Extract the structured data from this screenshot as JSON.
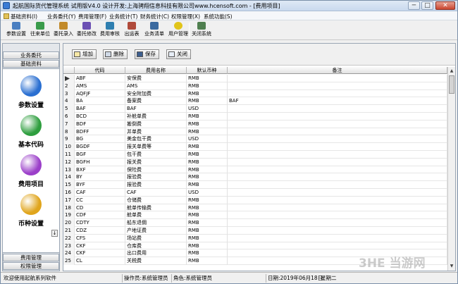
{
  "window": {
    "title": "起航国际货代管理系统 试用版V4.0 设计开发:上海骋翔信息科技有限公司www.hcensoft.com - [费用项目]",
    "min": "─",
    "max": "□",
    "close": "✕"
  },
  "menu": [
    "基础资料(I)",
    "业务委托(Y)",
    "费用管理(F)",
    "业务统计(T)",
    "财务统计(C)",
    "权限管理(X)",
    "系统功能(S)"
  ],
  "toolbar": [
    {
      "label": "参数设置",
      "icon": "gear-icon",
      "color": "#4a7fc1"
    },
    {
      "label": "往来单位",
      "icon": "people-icon",
      "color": "#3a9b4a"
    },
    {
      "label": "委托录入",
      "icon": "edit-icon",
      "color": "#c28a2a"
    },
    {
      "label": "委托修改",
      "icon": "modify-icon",
      "color": "#6b4fb3"
    },
    {
      "label": "费用审核",
      "icon": "audit-icon",
      "color": "#2f7fb0"
    },
    {
      "label": "出运表",
      "icon": "ship-icon",
      "color": "#b04a3a"
    },
    {
      "label": "业务清单",
      "icon": "list-icon",
      "color": "#3a6aa0"
    },
    {
      "label": "用户管理",
      "icon": "smile-icon",
      "color": "#e1c419"
    },
    {
      "label": "关闭系统",
      "icon": "door-icon",
      "color": "#4f7f4f"
    }
  ],
  "sidebar": {
    "top_headers": [
      "业务委托",
      "基础资料"
    ],
    "items": [
      {
        "label": "参数设置",
        "icon": "globe-icon",
        "color": "#2a6fd1"
      },
      {
        "label": "基本代码",
        "icon": "at-icon",
        "color": "#2e9e3e"
      },
      {
        "label": "费用项目",
        "icon": "orb-icon",
        "color": "#9b3fc9"
      },
      {
        "label": "币种设置",
        "icon": "coin-icon",
        "color": "#e0a51c"
      }
    ],
    "scroll": "↓",
    "bottom_headers": [
      "费用管理",
      "权限管理"
    ]
  },
  "actions": {
    "add": "增加",
    "delete": "删除",
    "save": "保存",
    "close": "关闭"
  },
  "grid": {
    "columns": [
      "代码",
      "费用名称",
      "默认币种",
      "备注"
    ],
    "rows": [
      [
        "",
        "ABF",
        "安保费",
        "RMB",
        ""
      ],
      [
        "2",
        "AMS",
        "AMS",
        "RMB",
        ""
      ],
      [
        "3",
        "AQFJF",
        "安全附加费",
        "RMB",
        ""
      ],
      [
        "4",
        "BA",
        "备案费",
        "RMB",
        "BAF"
      ],
      [
        "5",
        "BAF",
        "BAF",
        "USD",
        ""
      ],
      [
        "6",
        "BCD",
        "补舱单费",
        "RMB",
        ""
      ],
      [
        "7",
        "BDF",
        "搬倒费",
        "RMB",
        ""
      ],
      [
        "8",
        "BDFF",
        "并单费",
        "RMB",
        ""
      ],
      [
        "9",
        "BG",
        "美金包干费",
        "USD",
        ""
      ],
      [
        "10",
        "BGDF",
        "报关单费等",
        "RMB",
        ""
      ],
      [
        "11",
        "BGF",
        "包干费",
        "RMB",
        ""
      ],
      [
        "12",
        "BGFH",
        "报关费",
        "RMB",
        ""
      ],
      [
        "13",
        "BXF",
        "保险费",
        "RMB",
        ""
      ],
      [
        "14",
        "BY",
        "报验费",
        "RMB",
        ""
      ],
      [
        "15",
        "BYF",
        "报验费",
        "RMB",
        ""
      ],
      [
        "16",
        "CAF",
        "CAF",
        "USD",
        ""
      ],
      [
        "17",
        "CC",
        "仓储费",
        "RMB",
        ""
      ],
      [
        "18",
        "CD",
        "舱单传输费",
        "RMB",
        ""
      ],
      [
        "19",
        "CDF",
        "舱单费",
        "RMB",
        ""
      ],
      [
        "20",
        "CDTY",
        "船东退佣",
        "RMB",
        ""
      ],
      [
        "21",
        "CDZ",
        "产地证费",
        "RMB",
        ""
      ],
      [
        "22",
        "CFS",
        "场站费",
        "RMB",
        ""
      ],
      [
        "23",
        "CKF",
        "仓库费",
        "RMB",
        ""
      ],
      [
        "24",
        "CKF",
        "出口费用",
        "RMB",
        ""
      ],
      [
        "25",
        "CL",
        "关税费",
        "RMB",
        ""
      ]
    ]
  },
  "status": {
    "welcome": "欢迎使用起航系列软件",
    "operator": "操作员:系统管理员",
    "role": "角色:系统管理员",
    "date": "日期:2019年06月18日",
    "weekday": "星期二"
  },
  "watermark": "3HE 当游网"
}
